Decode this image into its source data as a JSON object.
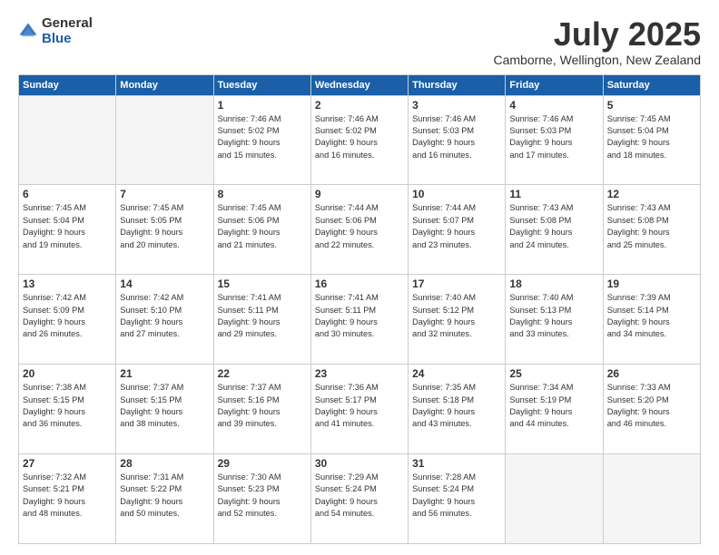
{
  "logo": {
    "general": "General",
    "blue": "Blue"
  },
  "title": "July 2025",
  "location": "Camborne, Wellington, New Zealand",
  "days_of_week": [
    "Sunday",
    "Monday",
    "Tuesday",
    "Wednesday",
    "Thursday",
    "Friday",
    "Saturday"
  ],
  "weeks": [
    [
      {
        "day": "",
        "empty": true
      },
      {
        "day": "",
        "empty": true
      },
      {
        "day": "1",
        "sunrise": "Sunrise: 7:46 AM",
        "sunset": "Sunset: 5:02 PM",
        "daylight": "Daylight: 9 hours and 15 minutes."
      },
      {
        "day": "2",
        "sunrise": "Sunrise: 7:46 AM",
        "sunset": "Sunset: 5:02 PM",
        "daylight": "Daylight: 9 hours and 16 minutes."
      },
      {
        "day": "3",
        "sunrise": "Sunrise: 7:46 AM",
        "sunset": "Sunset: 5:03 PM",
        "daylight": "Daylight: 9 hours and 16 minutes."
      },
      {
        "day": "4",
        "sunrise": "Sunrise: 7:46 AM",
        "sunset": "Sunset: 5:03 PM",
        "daylight": "Daylight: 9 hours and 17 minutes."
      },
      {
        "day": "5",
        "sunrise": "Sunrise: 7:45 AM",
        "sunset": "Sunset: 5:04 PM",
        "daylight": "Daylight: 9 hours and 18 minutes."
      }
    ],
    [
      {
        "day": "6",
        "sunrise": "Sunrise: 7:45 AM",
        "sunset": "Sunset: 5:04 PM",
        "daylight": "Daylight: 9 hours and 19 minutes."
      },
      {
        "day": "7",
        "sunrise": "Sunrise: 7:45 AM",
        "sunset": "Sunset: 5:05 PM",
        "daylight": "Daylight: 9 hours and 20 minutes."
      },
      {
        "day": "8",
        "sunrise": "Sunrise: 7:45 AM",
        "sunset": "Sunset: 5:06 PM",
        "daylight": "Daylight: 9 hours and 21 minutes."
      },
      {
        "day": "9",
        "sunrise": "Sunrise: 7:44 AM",
        "sunset": "Sunset: 5:06 PM",
        "daylight": "Daylight: 9 hours and 22 minutes."
      },
      {
        "day": "10",
        "sunrise": "Sunrise: 7:44 AM",
        "sunset": "Sunset: 5:07 PM",
        "daylight": "Daylight: 9 hours and 23 minutes."
      },
      {
        "day": "11",
        "sunrise": "Sunrise: 7:43 AM",
        "sunset": "Sunset: 5:08 PM",
        "daylight": "Daylight: 9 hours and 24 minutes."
      },
      {
        "day": "12",
        "sunrise": "Sunrise: 7:43 AM",
        "sunset": "Sunset: 5:08 PM",
        "daylight": "Daylight: 9 hours and 25 minutes."
      }
    ],
    [
      {
        "day": "13",
        "sunrise": "Sunrise: 7:42 AM",
        "sunset": "Sunset: 5:09 PM",
        "daylight": "Daylight: 9 hours and 26 minutes."
      },
      {
        "day": "14",
        "sunrise": "Sunrise: 7:42 AM",
        "sunset": "Sunset: 5:10 PM",
        "daylight": "Daylight: 9 hours and 27 minutes."
      },
      {
        "day": "15",
        "sunrise": "Sunrise: 7:41 AM",
        "sunset": "Sunset: 5:11 PM",
        "daylight": "Daylight: 9 hours and 29 minutes."
      },
      {
        "day": "16",
        "sunrise": "Sunrise: 7:41 AM",
        "sunset": "Sunset: 5:11 PM",
        "daylight": "Daylight: 9 hours and 30 minutes."
      },
      {
        "day": "17",
        "sunrise": "Sunrise: 7:40 AM",
        "sunset": "Sunset: 5:12 PM",
        "daylight": "Daylight: 9 hours and 32 minutes."
      },
      {
        "day": "18",
        "sunrise": "Sunrise: 7:40 AM",
        "sunset": "Sunset: 5:13 PM",
        "daylight": "Daylight: 9 hours and 33 minutes."
      },
      {
        "day": "19",
        "sunrise": "Sunrise: 7:39 AM",
        "sunset": "Sunset: 5:14 PM",
        "daylight": "Daylight: 9 hours and 34 minutes."
      }
    ],
    [
      {
        "day": "20",
        "sunrise": "Sunrise: 7:38 AM",
        "sunset": "Sunset: 5:15 PM",
        "daylight": "Daylight: 9 hours and 36 minutes."
      },
      {
        "day": "21",
        "sunrise": "Sunrise: 7:37 AM",
        "sunset": "Sunset: 5:15 PM",
        "daylight": "Daylight: 9 hours and 38 minutes."
      },
      {
        "day": "22",
        "sunrise": "Sunrise: 7:37 AM",
        "sunset": "Sunset: 5:16 PM",
        "daylight": "Daylight: 9 hours and 39 minutes."
      },
      {
        "day": "23",
        "sunrise": "Sunrise: 7:36 AM",
        "sunset": "Sunset: 5:17 PM",
        "daylight": "Daylight: 9 hours and 41 minutes."
      },
      {
        "day": "24",
        "sunrise": "Sunrise: 7:35 AM",
        "sunset": "Sunset: 5:18 PM",
        "daylight": "Daylight: 9 hours and 43 minutes."
      },
      {
        "day": "25",
        "sunrise": "Sunrise: 7:34 AM",
        "sunset": "Sunset: 5:19 PM",
        "daylight": "Daylight: 9 hours and 44 minutes."
      },
      {
        "day": "26",
        "sunrise": "Sunrise: 7:33 AM",
        "sunset": "Sunset: 5:20 PM",
        "daylight": "Daylight: 9 hours and 46 minutes."
      }
    ],
    [
      {
        "day": "27",
        "sunrise": "Sunrise: 7:32 AM",
        "sunset": "Sunset: 5:21 PM",
        "daylight": "Daylight: 9 hours and 48 minutes."
      },
      {
        "day": "28",
        "sunrise": "Sunrise: 7:31 AM",
        "sunset": "Sunset: 5:22 PM",
        "daylight": "Daylight: 9 hours and 50 minutes."
      },
      {
        "day": "29",
        "sunrise": "Sunrise: 7:30 AM",
        "sunset": "Sunset: 5:23 PM",
        "daylight": "Daylight: 9 hours and 52 minutes."
      },
      {
        "day": "30",
        "sunrise": "Sunrise: 7:29 AM",
        "sunset": "Sunset: 5:24 PM",
        "daylight": "Daylight: 9 hours and 54 minutes."
      },
      {
        "day": "31",
        "sunrise": "Sunrise: 7:28 AM",
        "sunset": "Sunset: 5:24 PM",
        "daylight": "Daylight: 9 hours and 56 minutes."
      },
      {
        "day": "",
        "empty": true
      },
      {
        "day": "",
        "empty": true
      }
    ]
  ]
}
